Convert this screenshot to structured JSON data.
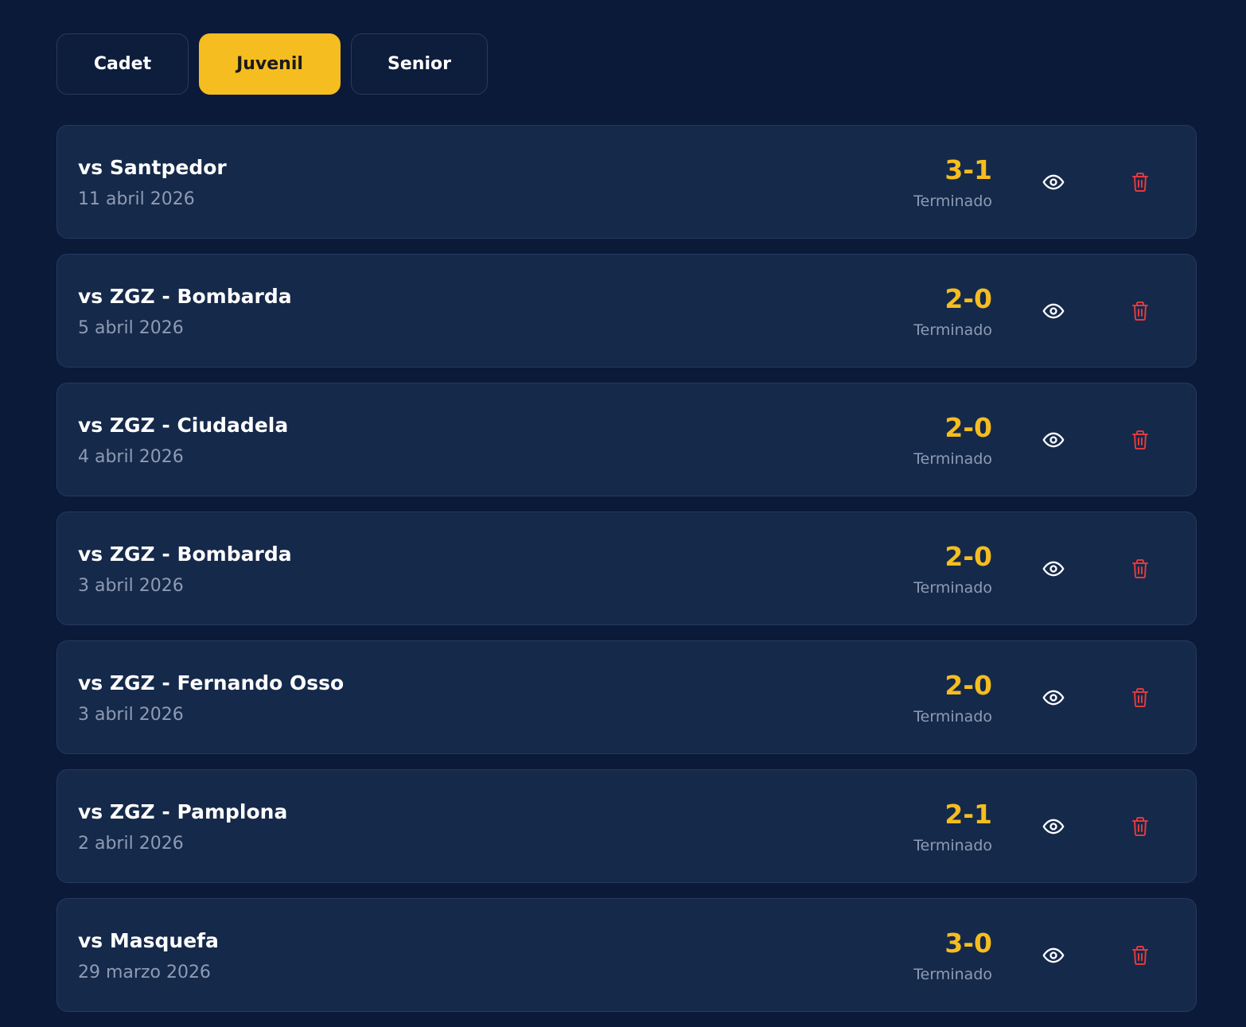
{
  "tabs": [
    {
      "label": "Cadet",
      "active": false
    },
    {
      "label": "Juvenil",
      "active": true
    },
    {
      "label": "Senior",
      "active": false
    }
  ],
  "colors": {
    "background": "#0b1a38",
    "card": "#15294a",
    "accent": "#f5bd1f",
    "danger": "#e03a3e",
    "muted": "#8e9bb4"
  },
  "icons": {
    "view": "eye-icon",
    "delete": "trash-icon"
  },
  "matches": [
    {
      "title": "vs Santpedor",
      "date": "11 abril 2026",
      "score": "3-1",
      "status": "Terminado"
    },
    {
      "title": "vs ZGZ - Bombarda",
      "date": "5 abril 2026",
      "score": "2-0",
      "status": "Terminado"
    },
    {
      "title": "vs ZGZ - Ciudadela",
      "date": "4 abril 2026",
      "score": "2-0",
      "status": "Terminado"
    },
    {
      "title": "vs ZGZ - Bombarda",
      "date": "3 abril 2026",
      "score": "2-0",
      "status": "Terminado"
    },
    {
      "title": "vs ZGZ - Fernando Osso",
      "date": "3 abril 2026",
      "score": "2-0",
      "status": "Terminado"
    },
    {
      "title": "vs ZGZ - Pamplona",
      "date": "2 abril 2026",
      "score": "2-1",
      "status": "Terminado"
    },
    {
      "title": "vs Masquefa",
      "date": "29 marzo 2026",
      "score": "3-0",
      "status": "Terminado"
    }
  ]
}
